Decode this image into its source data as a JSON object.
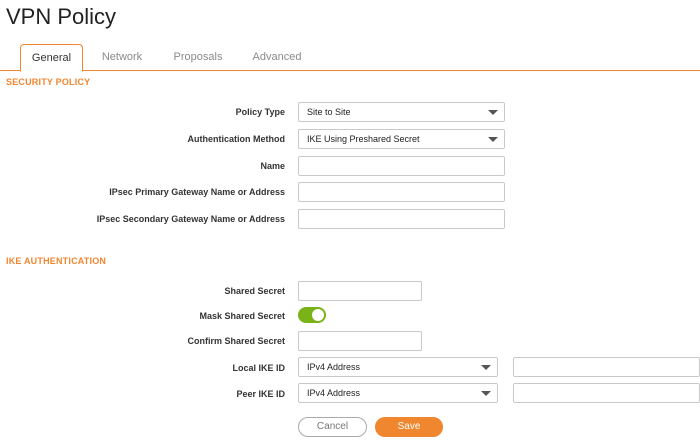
{
  "page": {
    "title": "VPN Policy"
  },
  "tabs": [
    {
      "label": "General",
      "active": true
    },
    {
      "label": "Network",
      "active": false
    },
    {
      "label": "Proposals",
      "active": false
    },
    {
      "label": "Advanced",
      "active": false
    }
  ],
  "security_policy": {
    "heading": "SECURITY POLICY",
    "policy_type": {
      "label": "Policy Type",
      "value": "Site to Site"
    },
    "auth_method": {
      "label": "Authentication Method",
      "value": "IKE Using Preshared Secret"
    },
    "name": {
      "label": "Name",
      "value": ""
    },
    "primary_gateway": {
      "label": "IPsec Primary Gateway Name or Address",
      "value": ""
    },
    "secondary_gateway": {
      "label": "IPsec Secondary Gateway Name or Address",
      "value": ""
    }
  },
  "ike_auth": {
    "heading": "IKE AUTHENTICATION",
    "shared_secret": {
      "label": "Shared Secret",
      "value": ""
    },
    "mask_shared_secret": {
      "label": "Mask Shared Secret",
      "enabled": true
    },
    "confirm_shared_secret": {
      "label": "Confirm Shared Secret",
      "value": ""
    },
    "local_ike_id": {
      "label": "Local IKE ID",
      "type": "IPv4 Address",
      "value": ""
    },
    "peer_ike_id": {
      "label": "Peer IKE ID",
      "type": "IPv4 Address",
      "value": ""
    }
  },
  "actions": {
    "cancel": "Cancel",
    "save": "Save"
  },
  "colors": {
    "accent": "#f0862e",
    "toggle_on": "#7ab317"
  }
}
